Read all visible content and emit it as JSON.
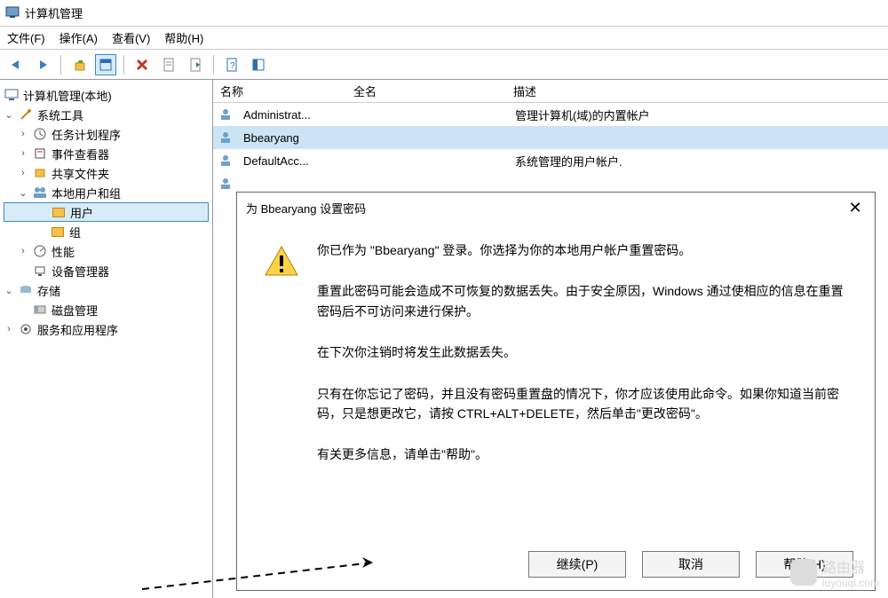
{
  "window": {
    "title": "计算机管理"
  },
  "menu": {
    "file": "文件(F)",
    "action": "操作(A)",
    "view": "查看(V)",
    "help": "帮助(H)"
  },
  "tree": {
    "root": "计算机管理(本地)",
    "sys_tools": "系统工具",
    "task_sched": "任务计划程序",
    "event_viewer": "事件查看器",
    "shared_folders": "共享文件夹",
    "local_users": "本地用户和组",
    "users": "用户",
    "groups": "组",
    "performance": "性能",
    "device_mgr": "设备管理器",
    "storage": "存储",
    "disk_mgmt": "磁盘管理",
    "services_apps": "服务和应用程序"
  },
  "list": {
    "col_name": "名称",
    "col_fullname": "全名",
    "col_desc": "描述",
    "rows": [
      {
        "name": "Administrat...",
        "fullname": "",
        "desc": "管理计算机(域)的内置帐户"
      },
      {
        "name": "Bbearyang",
        "fullname": "",
        "desc": ""
      },
      {
        "name": "DefaultAcc...",
        "fullname": "",
        "desc": "系统管理的用户帐户."
      }
    ]
  },
  "dialog": {
    "title": "为 Bbearyang 设置密码",
    "p1": "你已作为 \"Bbearyang\" 登录。你选择为你的本地用户帐户重置密码。",
    "p2": "重置此密码可能会造成不可恢复的数据丢失。由于安全原因，Windows 通过使相应的信息在重置密码后不可访问来进行保护。",
    "p3": "在下次你注销时将发生此数据丢失。",
    "p4": "只有在你忘记了密码，并且没有密码重置盘的情况下，你才应该使用此命令。如果你知道当前密码，只是想更改它，请按 CTRL+ALT+DELETE，然后单击\"更改密码\"。",
    "p5": "有关更多信息，请单击\"帮助\"。",
    "btn_continue": "继续(P)",
    "btn_cancel": "取消",
    "btn_help": "帮助(H)"
  },
  "watermark": {
    "text": "路由器",
    "sub": "luyouqi.com"
  }
}
